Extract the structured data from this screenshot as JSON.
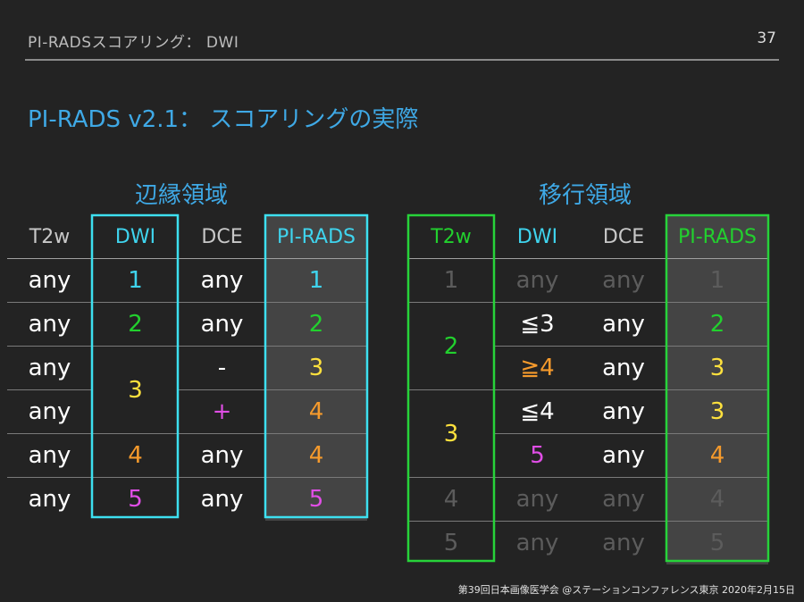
{
  "header": {
    "title": "PI-RADSスコアリング： DWI",
    "page_number": "37"
  },
  "main_title": "PI-RADS v2.1： スコアリングの実際",
  "colors": {
    "white": "#ffffff",
    "cyan": "#3fd4ee",
    "green": "#22d02e",
    "yellow": "#ffe13d",
    "orange": "#f59a2c",
    "magenta": "#e04ee6",
    "dim": "#5c5c5c",
    "frame_cyan": "#3de0f0",
    "frame_green": "#27d33a",
    "title_blue": "#3fa9e6"
  },
  "peripheral": {
    "title": "辺縁領域",
    "headers": [
      "T2w",
      "DWI",
      "DCE",
      "PI-RADS"
    ],
    "rows": [
      {
        "t2w": "any",
        "dwi": "1",
        "dce": "any",
        "pirads": "1"
      },
      {
        "t2w": "any",
        "dwi": "2",
        "dce": "any",
        "pirads": "2"
      },
      {
        "t2w": "any",
        "dwi": "3",
        "dce": "-",
        "pirads": "3"
      },
      {
        "t2w": "any",
        "dce": "+",
        "pirads": "4"
      },
      {
        "t2w": "any",
        "dwi": "4",
        "dce": "any",
        "pirads": "4"
      },
      {
        "t2w": "any",
        "dwi": "5",
        "dce": "any",
        "pirads": "5"
      }
    ]
  },
  "transition": {
    "title": "移行領域",
    "headers": [
      "T2w",
      "DWI",
      "DCE",
      "PI-RADS"
    ],
    "rows": [
      {
        "t2w": "1",
        "dwi": "any",
        "dce": "any",
        "pirads": "1"
      },
      {
        "t2w": "2",
        "dwi": "≦3",
        "dce": "any",
        "pirads": "2"
      },
      {
        "dwi": "≧4",
        "dce": "any",
        "pirads": "3"
      },
      {
        "t2w": "3",
        "dwi": "≦4",
        "dce": "any",
        "pirads": "3"
      },
      {
        "dwi": "5",
        "dce": "any",
        "pirads": "4"
      },
      {
        "t2w": "4",
        "dwi": "any",
        "dce": "any",
        "pirads": "4"
      },
      {
        "t2w": "5",
        "dwi": "any",
        "dce": "any",
        "pirads": "5"
      }
    ]
  },
  "footer": "第39回日本画像医学会 @ステーションコンファレンス東京 2020年2月15日"
}
